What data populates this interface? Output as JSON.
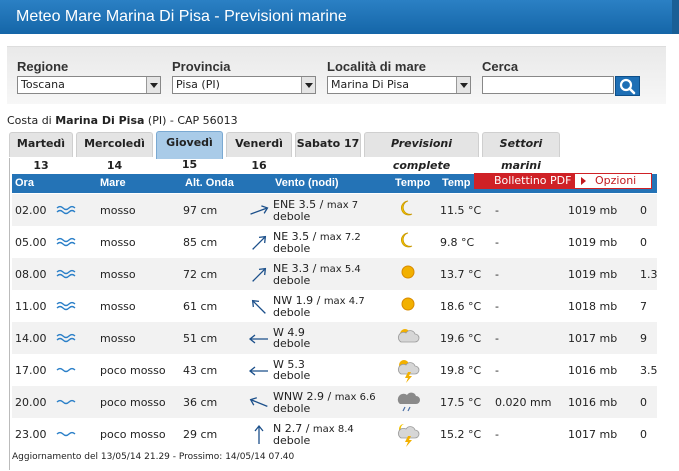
{
  "title": "Meteo Mare Marina Di Pisa - Previsioni marine",
  "search": {
    "region_label": "Regione",
    "region_value": "Toscana",
    "province_label": "Provincia",
    "province_value": "Pisa (PI)",
    "locality_label": "Località di mare",
    "locality_value": "Marina Di Pisa",
    "search_label": "Cerca"
  },
  "coast": {
    "prefix": "Costa di",
    "name": "Marina Di Pisa",
    "suffix": "(PI) - CAP 56013"
  },
  "tabs": [
    "Martedì 13",
    "Mercoledì 14",
    "Giovedì 15",
    "Venerdì 16",
    "Sabato 17",
    "Previsioni complete",
    "Settori marini"
  ],
  "options": {
    "pdf": "Bollettino PDF",
    "opzioni": "Opzioni"
  },
  "columns": {
    "ora": "Ora",
    "mare": "Mare",
    "onda": "Alt. Onda",
    "vento": "Vento (nodi)",
    "tempo": "Tempo",
    "temp": "Temp"
  },
  "rows": [
    {
      "time": "02.00",
      "sea": "mosso",
      "wave": "97 cm",
      "dir": "ENE",
      "speed": "3.5",
      "max": "max 7",
      "force": "debole",
      "weather": "moon",
      "temp": "11.5 °C",
      "rain": "-",
      "pressure": "1019 mb",
      "extra": "0",
      "rot": 250
    },
    {
      "time": "05.00",
      "sea": "mosso",
      "wave": "85 cm",
      "dir": "NE",
      "speed": "3.5",
      "max": "max 7.2",
      "force": "debole",
      "weather": "moon",
      "temp": "9.8 °C",
      "rain": "-",
      "pressure": "1019 mb",
      "extra": "0",
      "rot": 225
    },
    {
      "time": "08.00",
      "sea": "mosso",
      "wave": "72 cm",
      "dir": "NE",
      "speed": "3.3",
      "max": "max 5.4",
      "force": "debole",
      "weather": "sun",
      "temp": "13.7 °C",
      "rain": "-",
      "pressure": "1019 mb",
      "extra": "1.3",
      "rot": 225
    },
    {
      "time": "11.00",
      "sea": "mosso",
      "wave": "61 cm",
      "dir": "NW",
      "speed": "1.9",
      "max": "max 4.7",
      "force": "debole",
      "weather": "sun",
      "temp": "18.6 °C",
      "rain": "-",
      "pressure": "1018 mb",
      "extra": "7",
      "rot": 135
    },
    {
      "time": "14.00",
      "sea": "mosso",
      "wave": "51 cm",
      "dir": "W",
      "speed": "4.9",
      "max": "",
      "force": "debole",
      "weather": "sun-cloud",
      "temp": "19.6 °C",
      "rain": "-",
      "pressure": "1017 mb",
      "extra": "9",
      "rot": 90
    },
    {
      "time": "17.00",
      "sea": "poco mosso",
      "wave": "43 cm",
      "dir": "W",
      "speed": "5.3",
      "max": "",
      "force": "debole",
      "weather": "storm-sun",
      "temp": "19.8 °C",
      "rain": "-",
      "pressure": "1016 mb",
      "extra": "3.5",
      "rot": 90
    },
    {
      "time": "20.00",
      "sea": "poco mosso",
      "wave": "36 cm",
      "dir": "WNW",
      "speed": "2.9",
      "max": "max 6.6",
      "force": "debole",
      "weather": "rain-cloud",
      "temp": "17.5 °C",
      "rain": "0.020 mm",
      "pressure": "1016 mb",
      "extra": "0",
      "rot": 112
    },
    {
      "time": "23.00",
      "sea": "poco mosso",
      "wave": "29 cm",
      "dir": "N",
      "speed": "2.7",
      "max": "max 8.4",
      "force": "debole",
      "weather": "storm-moon",
      "temp": "15.2 °C",
      "rain": "-",
      "pressure": "1017 mb",
      "extra": "0",
      "rot": 180
    }
  ],
  "footer": "Aggiornamento del 13/05/14 21.29 - Prossimo: 14/05/14 07.40",
  "colors": {
    "header": "#2473b6",
    "accent": "#cf2126",
    "tab_active": "#a9cbe8"
  }
}
